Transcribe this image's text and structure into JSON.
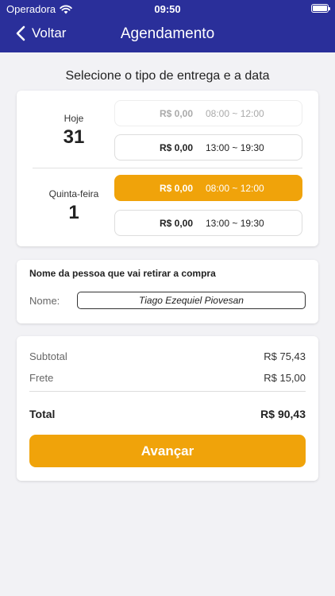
{
  "status_bar": {
    "carrier": "Operadora",
    "time": "09:50"
  },
  "nav": {
    "back_label": "Voltar",
    "title": "Agendamento"
  },
  "subtitle": "Selecione o tipo de entrega e a data",
  "days": [
    {
      "name": "Hoje",
      "number": "31",
      "slots": [
        {
          "price": "R$ 0,00",
          "time": "08:00 ~ 12:00",
          "state": "disabled"
        },
        {
          "price": "R$ 0,00",
          "time": "13:00 ~ 19:30",
          "state": "available"
        }
      ]
    },
    {
      "name": "Quinta-feira",
      "number": "1",
      "slots": [
        {
          "price": "R$ 0,00",
          "time": "08:00 ~ 12:00",
          "state": "selected"
        },
        {
          "price": "R$ 0,00",
          "time": "13:00 ~ 19:30",
          "state": "available"
        }
      ]
    }
  ],
  "pickup": {
    "heading": "Nome da pessoa que vai retirar a compra",
    "label": "Nome:",
    "value": "Tiago Ezequiel Piovesan"
  },
  "summary": {
    "subtotal_label": "Subtotal",
    "subtotal_value": "R$ 75,43",
    "frete_label": "Frete",
    "frete_value": "R$ 15,00",
    "total_label": "Total",
    "total_value": "R$ 90,43",
    "advance_label": "Avançar"
  },
  "colors": {
    "header": "#2a2f9a",
    "accent": "#f0a30a"
  }
}
